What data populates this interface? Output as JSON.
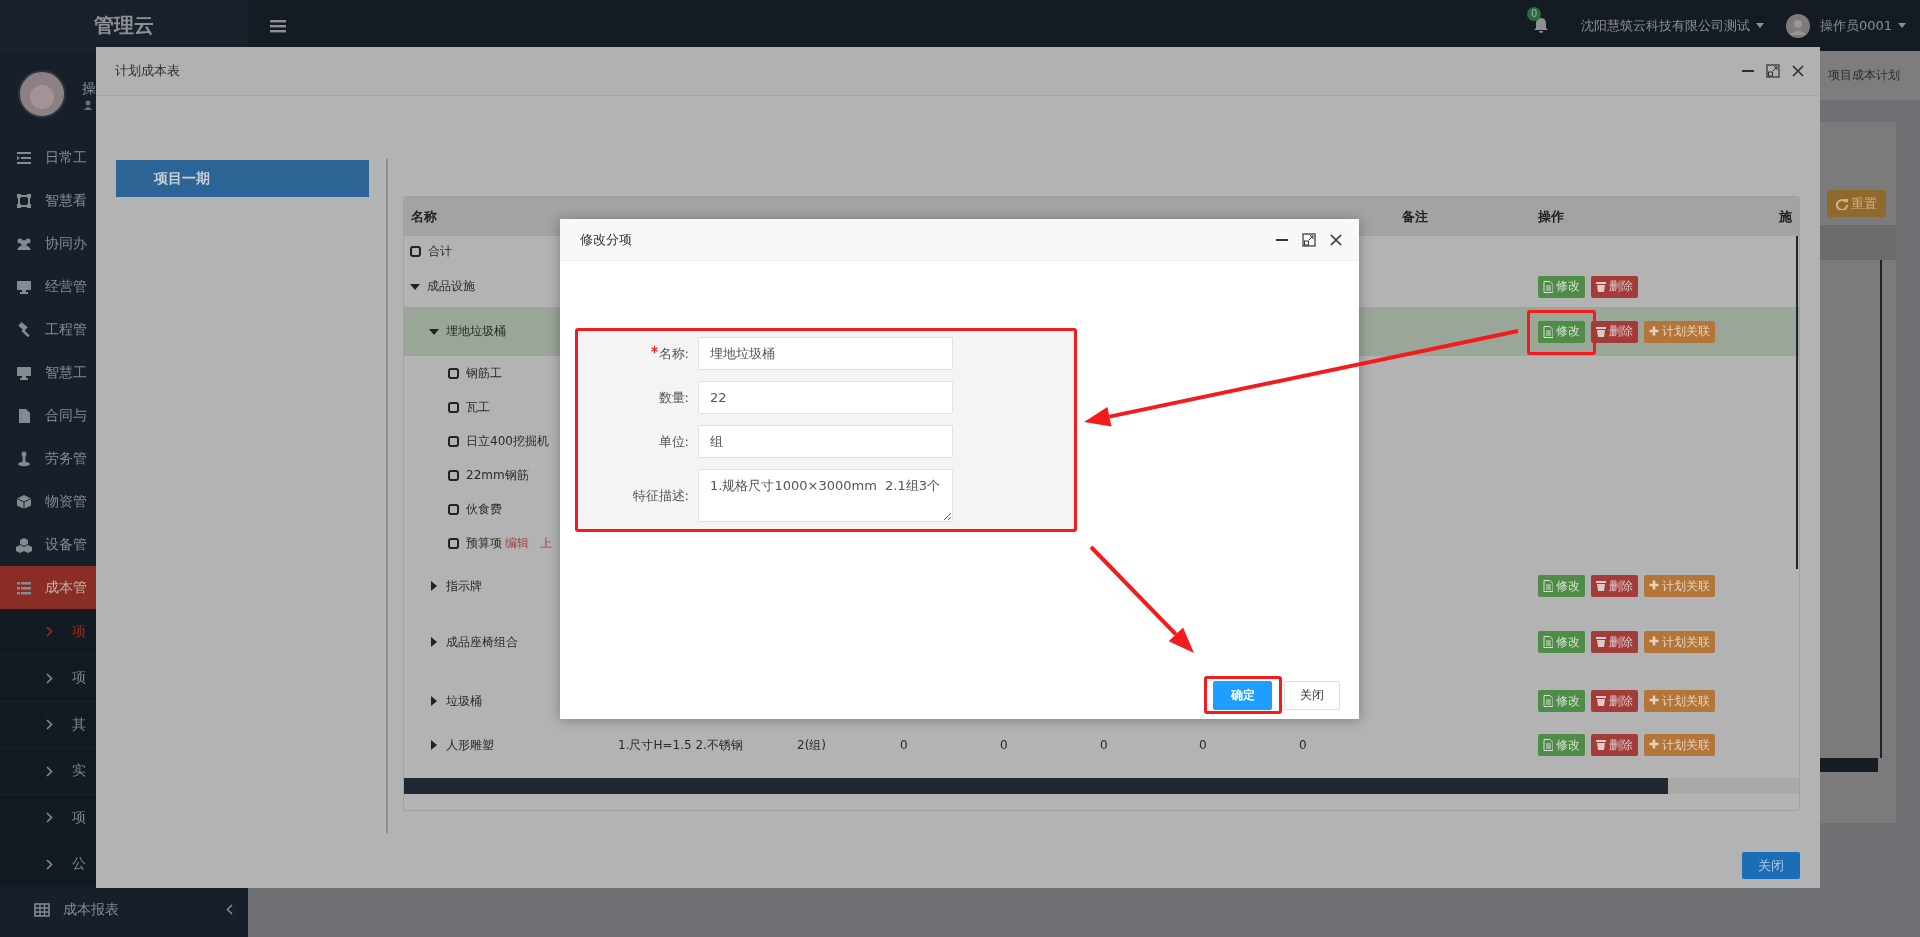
{
  "top_bar": {
    "logo": "管理云",
    "notification_count": "0",
    "company": "沈阳慧筑云科技有限公司测试",
    "user": "操作员0001"
  },
  "sidebar": {
    "user_name": "操",
    "items": [
      {
        "label": "日常工",
        "selected": false
      },
      {
        "label": "智慧看",
        "selected": false
      },
      {
        "label": "协同办",
        "selected": false
      },
      {
        "label": "经营管",
        "selected": false
      },
      {
        "label": "工程管",
        "selected": false
      },
      {
        "label": "智慧工",
        "selected": false
      },
      {
        "label": "合同与",
        "selected": false
      },
      {
        "label": "劳务管",
        "selected": false
      },
      {
        "label": "物资管",
        "selected": false
      },
      {
        "label": "设备管",
        "selected": false
      },
      {
        "label": "成本管",
        "selected": true,
        "expanded": true,
        "children": [
          {
            "label": "项",
            "selected": true
          },
          {
            "label": "项",
            "selected": false
          },
          {
            "label": "其",
            "selected": false
          },
          {
            "label": "实",
            "selected": false
          },
          {
            "label": "项",
            "selected": false
          },
          {
            "label": "公",
            "selected": false
          }
        ]
      },
      {
        "label": "成本报表",
        "selected": false,
        "expanded": false
      }
    ]
  },
  "background_page": {
    "breadcrumb": "项目成本计划",
    "reset_button": "重置"
  },
  "plan_modal": {
    "title": "计划成本表",
    "projects": [
      {
        "label": "项目一期",
        "selected": true
      }
    ],
    "table": {
      "columns": [
        "名称",
        "备注",
        "操作",
        "施"
      ],
      "rows": [
        {
          "name": "合计",
          "kind": "leaf",
          "selected": false
        },
        {
          "name": "成品设施",
          "kind": "group",
          "expanded": true,
          "selected": false,
          "actions": [
            {
              "kind": "edit",
              "label": "修改"
            },
            {
              "kind": "delete",
              "label": "删除"
            }
          ],
          "children": [
            {
              "name": "埋地垃圾桶",
              "kind": "group",
              "expanded": true,
              "selected": true,
              "actions": [
                {
                  "kind": "edit",
                  "label": "修改",
                  "highlighted": true
                },
                {
                  "kind": "delete",
                  "label": "删除"
                },
                {
                  "kind": "link",
                  "label": "计划关联"
                }
              ],
              "children": [
                {
                  "name": "钢筋工",
                  "kind": "leaf",
                  "selected": false
                },
                {
                  "name": "瓦工",
                  "kind": "leaf",
                  "selected": false
                },
                {
                  "name": "日立400挖掘机",
                  "kind": "leaf",
                  "selected": false
                },
                {
                  "name": "22mm钢筋",
                  "kind": "leaf",
                  "selected": false
                },
                {
                  "name": "伙食费",
                  "kind": "leaf",
                  "selected": false
                },
                {
                  "name": "预算项",
                  "kind": "leaf",
                  "selected": false,
                  "links": [
                    "编辑",
                    "上"
                  ]
                }
              ]
            },
            {
              "name": "指示牌",
              "kind": "group",
              "expanded": false,
              "selected": false,
              "actions": [
                {
                  "kind": "edit",
                  "label": "修改"
                },
                {
                  "kind": "delete",
                  "label": "删除"
                },
                {
                  "kind": "link",
                  "label": "计划关联"
                }
              ]
            },
            {
              "name": "成品座椅组合",
              "kind": "group",
              "expanded": false,
              "selected": false,
              "actions": [
                {
                  "kind": "edit",
                  "label": "修改"
                },
                {
                  "kind": "delete",
                  "label": "删除"
                },
                {
                  "kind": "link",
                  "label": "计划关联"
                }
              ]
            },
            {
              "name": "垃圾桶",
              "kind": "group",
              "expanded": false,
              "selected": false,
              "actions": [
                {
                  "kind": "edit",
                  "label": "修改"
                },
                {
                  "kind": "delete",
                  "label": "删除"
                },
                {
                  "kind": "link",
                  "label": "计划关联"
                }
              ]
            },
            {
              "name": "人形雕塑",
              "kind": "group",
              "expanded": false,
              "selected": false,
              "cells": [
                "1.尺寸H=1.5 2.不锈钢",
                "2(组)",
                "0",
                "0",
                "0",
                "0",
                "0"
              ],
              "actions": [
                {
                  "kind": "edit",
                  "label": "修改"
                },
                {
                  "kind": "delete",
                  "label": "删除"
                },
                {
                  "kind": "link",
                  "label": "计划关联"
                }
              ]
            }
          ]
        }
      ]
    },
    "close_button": "关闭"
  },
  "edit_dialog": {
    "title": "修改分项",
    "highlighted": true,
    "fields": [
      {
        "kind": "input",
        "label": "名称:",
        "required": true,
        "value": "埋地垃圾桶"
      },
      {
        "kind": "input",
        "label": "数量:",
        "required": false,
        "value": "22"
      },
      {
        "kind": "input",
        "label": "单位:",
        "required": false,
        "value": "组"
      },
      {
        "kind": "textarea",
        "label": "特征描述:",
        "required": false,
        "value": "1.规格尺寸1000×3000mm  2.1组3个"
      }
    ],
    "buttons": [
      {
        "kind": "primary",
        "label": "确定",
        "highlighted": true
      },
      {
        "kind": "default",
        "label": "关闭",
        "highlighted": false
      }
    ]
  }
}
